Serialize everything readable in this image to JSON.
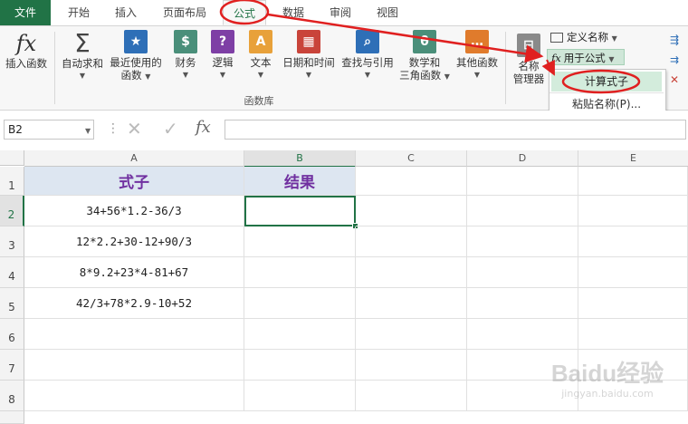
{
  "tabs": [
    "文件",
    "开始",
    "插入",
    "页面布局",
    "公式",
    "数据",
    "审阅",
    "视图"
  ],
  "ribbon": {
    "insert_function": "插入函数",
    "autosum": "自动求和",
    "recent_l1": "最近使用的",
    "recent_l2": "函数",
    "financial": "财务",
    "logical": "逻辑",
    "text": "文本",
    "datetime": "日期和时间",
    "lookup": "查找与引用",
    "math_l1": "数学和",
    "math_l2": "三角函数",
    "more": "其他函数",
    "name_mgr_l1": "名称",
    "name_mgr_l2": "管理器",
    "define_name": "定义名称",
    "use_in_formula": "用于公式",
    "group_label": "函数库",
    "icon_fx": "fx",
    "icon_sigma": "Σ"
  },
  "dropdown": {
    "item1": "计算式子",
    "item2": "粘贴名称(P)..."
  },
  "formula_bar": {
    "name_box": "B2",
    "fx": "fx",
    "formula": ""
  },
  "sheet": {
    "columns": [
      "A",
      "B",
      "C",
      "D",
      "E"
    ],
    "rows": [
      "1",
      "2",
      "3",
      "4",
      "5",
      "6",
      "7",
      "8"
    ],
    "header_a": "式子",
    "header_b": "结果",
    "formulas": [
      "34+56*1.2-36/3",
      "12*2.2+30-12+90/3",
      "8*9.2+23*4-81+67",
      "42/3+78*2.9-10+52"
    ]
  },
  "watermark": {
    "brand": "Baidu经验",
    "url": "jingyan.baidu.com"
  },
  "colors": {
    "excel_green": "#217346",
    "header_fill": "#dde6f1",
    "header_text": "#7030a0",
    "annotation_red": "#e02020"
  }
}
